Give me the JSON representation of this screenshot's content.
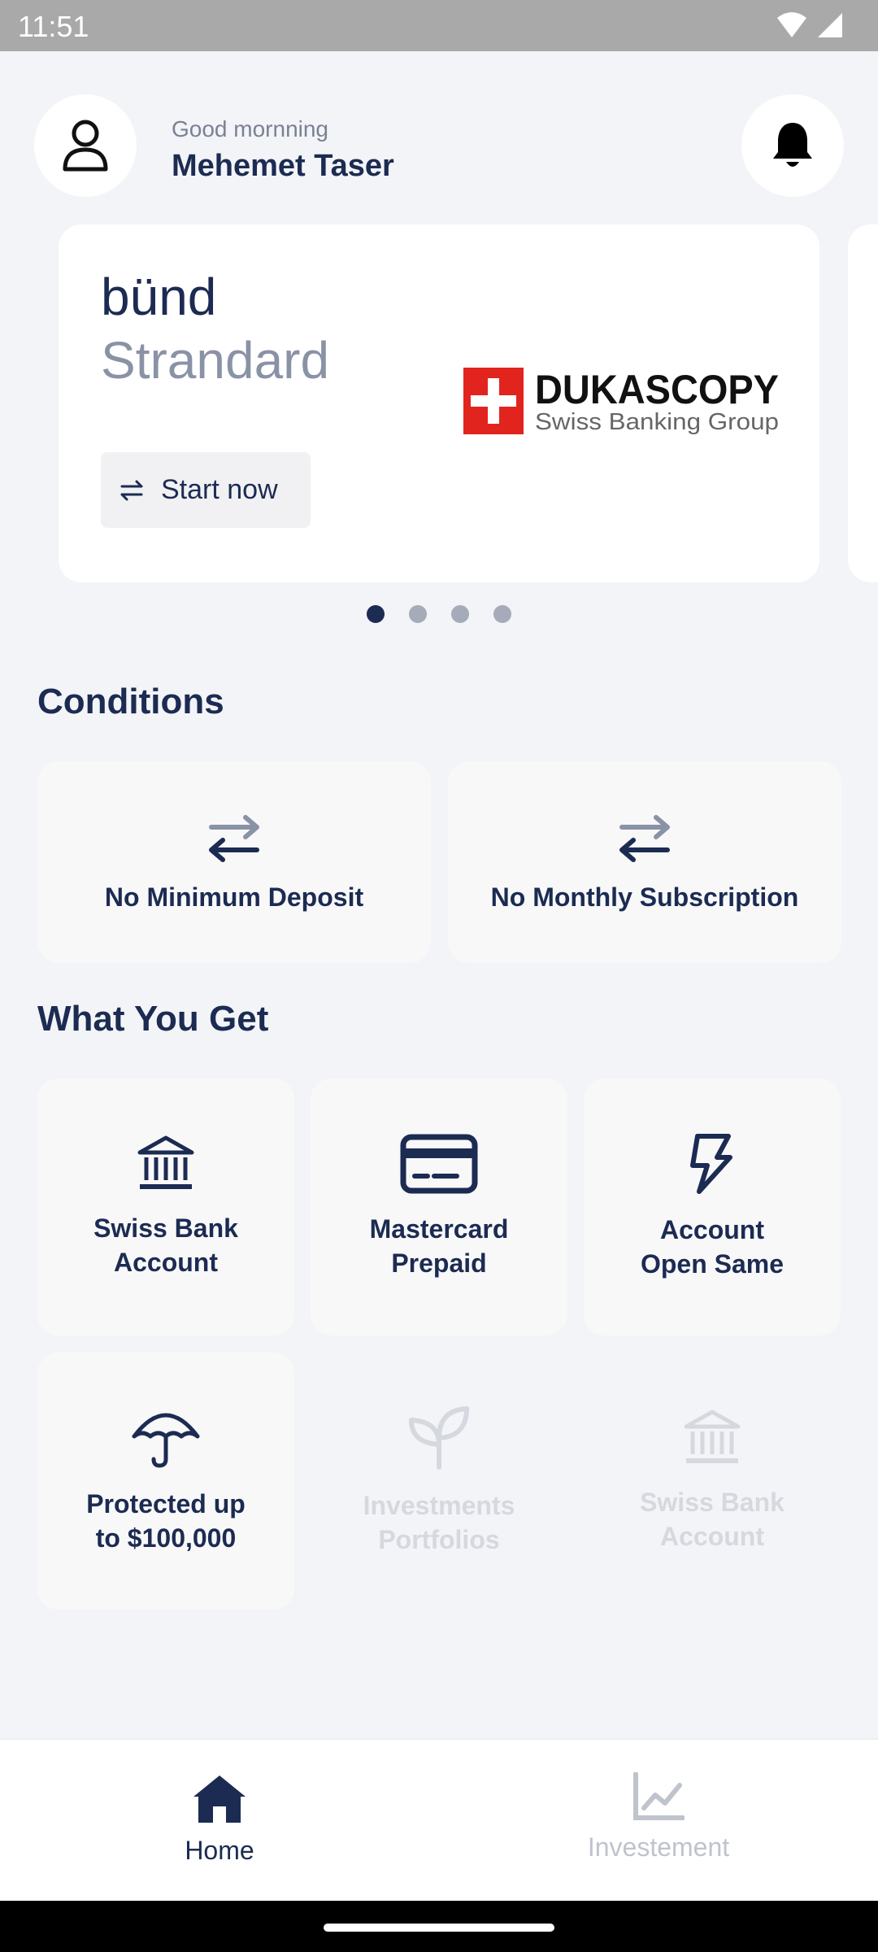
{
  "status_bar": {
    "time": "11:51"
  },
  "header": {
    "greeting": "Good mornning",
    "user_name": "Mehemet Taser"
  },
  "promo_card": {
    "brand_line1": "bünd",
    "brand_line2": "Strandard",
    "start_label": "Start now",
    "partner_logo": {
      "name": "DUKASCOPY",
      "tagline": "Swiss Banking Group"
    }
  },
  "carousel": {
    "page_count": 4,
    "active_index": 0
  },
  "conditions": {
    "title": "Conditions",
    "items": [
      {
        "label": "No Minimum Deposit",
        "icon": "arrows-exchange-icon"
      },
      {
        "label": "No Monthly Subscription",
        "icon": "arrows-exchange-icon"
      }
    ]
  },
  "features": {
    "title": "What You Get",
    "items": [
      {
        "line1": "Swiss Bank",
        "line2": "Account",
        "icon": "bank-icon"
      },
      {
        "line1": "Mastercard",
        "line2": "Prepaid",
        "icon": "credit-card-icon"
      },
      {
        "line1": "Account",
        "line2": "Open Same",
        "icon": "lightning-icon"
      },
      {
        "line1": "Protected up",
        "line2": "to $100,000",
        "icon": "umbrella-icon"
      },
      {
        "line1": "Investments",
        "line2": "Portfolios",
        "icon": "sprout-icon"
      },
      {
        "line1": "Swiss Bank",
        "line2": "Account",
        "icon": "bank-icon"
      }
    ]
  },
  "bottom_nav": {
    "items": [
      {
        "label": "Home",
        "icon": "home-icon",
        "active": true
      },
      {
        "label": "Investement",
        "icon": "chart-line-icon",
        "active": false
      }
    ]
  },
  "colors": {
    "primary": "#1c2b52",
    "muted": "#8a92a6",
    "background": "#f3f4f7",
    "inactive": "#bfc3cc"
  }
}
